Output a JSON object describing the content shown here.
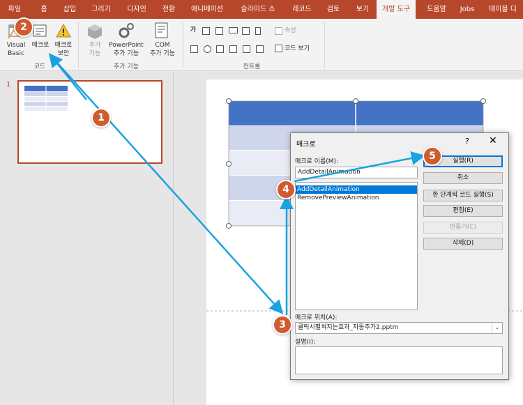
{
  "tabs": [
    "파일",
    "홈",
    "삽입",
    "그리기",
    "디자인",
    "전환",
    "애니메이션",
    "슬라이드 쇼",
    "레코드",
    "검토",
    "보기",
    "개발 도구",
    "도움말",
    "Jobs",
    "테이블 디"
  ],
  "active_tab": "개발 도구",
  "ribbon": {
    "code_group": {
      "label": "코드",
      "visual_basic": "Visual Basic",
      "visual_basic_line1": "Visual",
      "visual_basic_line2": "Basic",
      "macro": "매크로",
      "macro_security_line1": "매크로",
      "macro_security_line2": "보안"
    },
    "addins_group": {
      "label": "추가 기능",
      "addins_line1": "추가",
      "addins_line2": "기능",
      "ppt_addins_line1": "PowerPoint",
      "ppt_addins_line2": "추가 기능",
      "com_addins_line1": "COM",
      "com_addins_line2": "추가 기능"
    },
    "controls_group": {
      "label": "컨트롤",
      "label_control": "가",
      "properties": "속성",
      "view_code": "코드 보기"
    }
  },
  "thumbnails": {
    "slide_number": "1"
  },
  "dialog": {
    "title": "매크로",
    "help": "?",
    "close": "✕",
    "macro_name_label": "매크로 이름(M):",
    "macro_name_value": "AddDetailAnimation",
    "macros": [
      "AddDetailAnimation",
      "RemovePreviewAnimation"
    ],
    "selected_macro": "AddDetailAnimation",
    "buttons": {
      "run": "실행(R)",
      "cancel": "취소",
      "step_into": "한 단계씩 코드 실행(S)",
      "edit": "편집(E)",
      "create": "만들기(C)",
      "delete": "삭제(D)"
    },
    "macro_in_label": "매크로 위치(A):",
    "macro_in_value": "클릭시펼쳐지는효과_자동추가2.pptm",
    "description_label": "설명(I):",
    "description_value": ""
  },
  "markers": [
    "1",
    "2",
    "3",
    "4",
    "5"
  ],
  "colors": {
    "accent": "#b7472a",
    "marker": "#cf5b2f",
    "arrow": "#1aa3df",
    "table_header": "#4472c4",
    "table_band": "#cfd5ea",
    "table_band_light": "#e9ebf5",
    "selection": "#0078d7"
  }
}
